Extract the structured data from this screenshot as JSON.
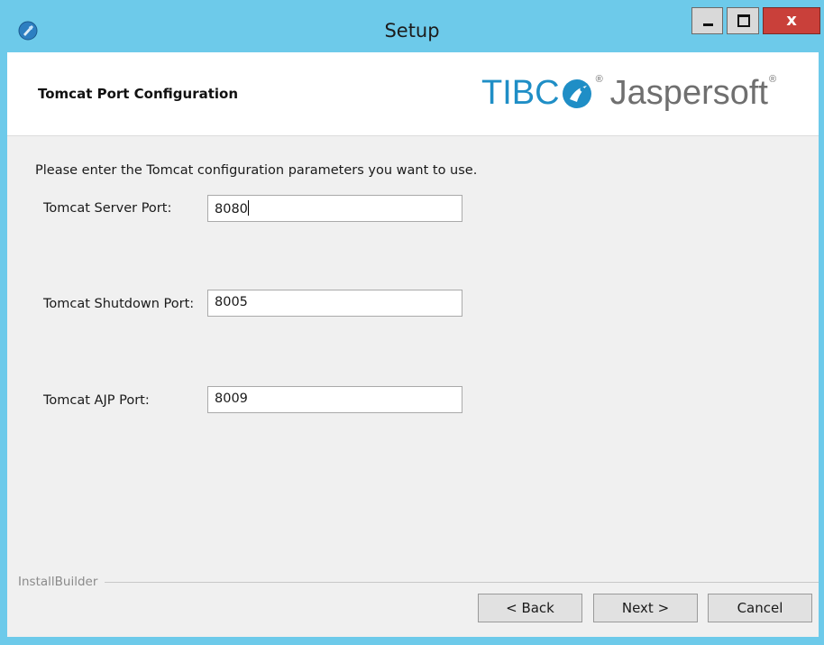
{
  "window": {
    "title": "Setup",
    "icon": "installer-icon",
    "controls": {
      "minimize": "minimize-icon",
      "maximize": "maximize-icon",
      "close_glyph": "x"
    },
    "colors": {
      "titlebar": "#6dcaea",
      "close": "#c9403a"
    }
  },
  "header": {
    "page_title": "Tomcat Port Configuration",
    "logo": {
      "part1": "TIBC",
      "part2": "Jaspersoft",
      "registered": "®",
      "brand_blue": "#1f8ec6",
      "brand_gray": "#6f6f6f"
    }
  },
  "form": {
    "instruction": "Please enter the Tomcat configuration parameters you want to use.",
    "fields": [
      {
        "label": "Tomcat Server Port:",
        "value": "8080"
      },
      {
        "label": "Tomcat Shutdown Port:",
        "value": "8005"
      },
      {
        "label": "Tomcat AJP Port:",
        "value": "8009"
      }
    ]
  },
  "footer": {
    "brand": "InstallBuilder",
    "buttons": {
      "back": "< Back",
      "next": "Next >",
      "cancel": "Cancel"
    }
  }
}
